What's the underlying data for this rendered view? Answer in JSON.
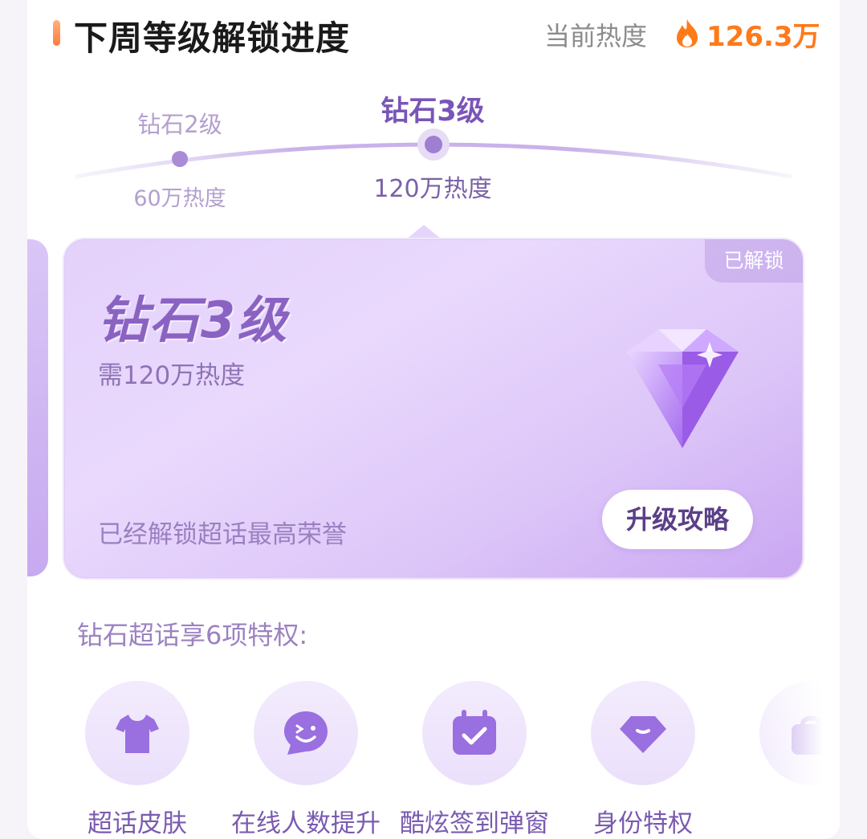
{
  "header": {
    "title": "下周等级解锁进度",
    "heat_label": "当前热度",
    "heat_value": "126.3万"
  },
  "progress": {
    "prev_level": {
      "name": "钻石2级",
      "heat": "60万热度"
    },
    "current_level": {
      "name": "钻石3级",
      "heat": "120万热度"
    }
  },
  "card": {
    "badge": "已解锁",
    "title": "钻石3级",
    "requirement": "需120万热度",
    "description": "已经解锁超话最高荣誉",
    "button_label": "升级攻略"
  },
  "privileges": {
    "heading": "钻石超话享6项特权:",
    "items": [
      {
        "label": "超话皮肤",
        "icon": "tshirt-icon"
      },
      {
        "label": "在线人数提升",
        "icon": "smile-chat-icon"
      },
      {
        "label": "酷炫签到弹窗",
        "icon": "calendar-check-icon"
      },
      {
        "label": "身份特权",
        "icon": "diamond-badge-icon"
      },
      {
        "label": "",
        "icon": "bag-icon"
      }
    ]
  },
  "colors": {
    "accent": "#8a63c2",
    "heat": "#ff7a1a",
    "card_bg": "#e3d1fb"
  }
}
